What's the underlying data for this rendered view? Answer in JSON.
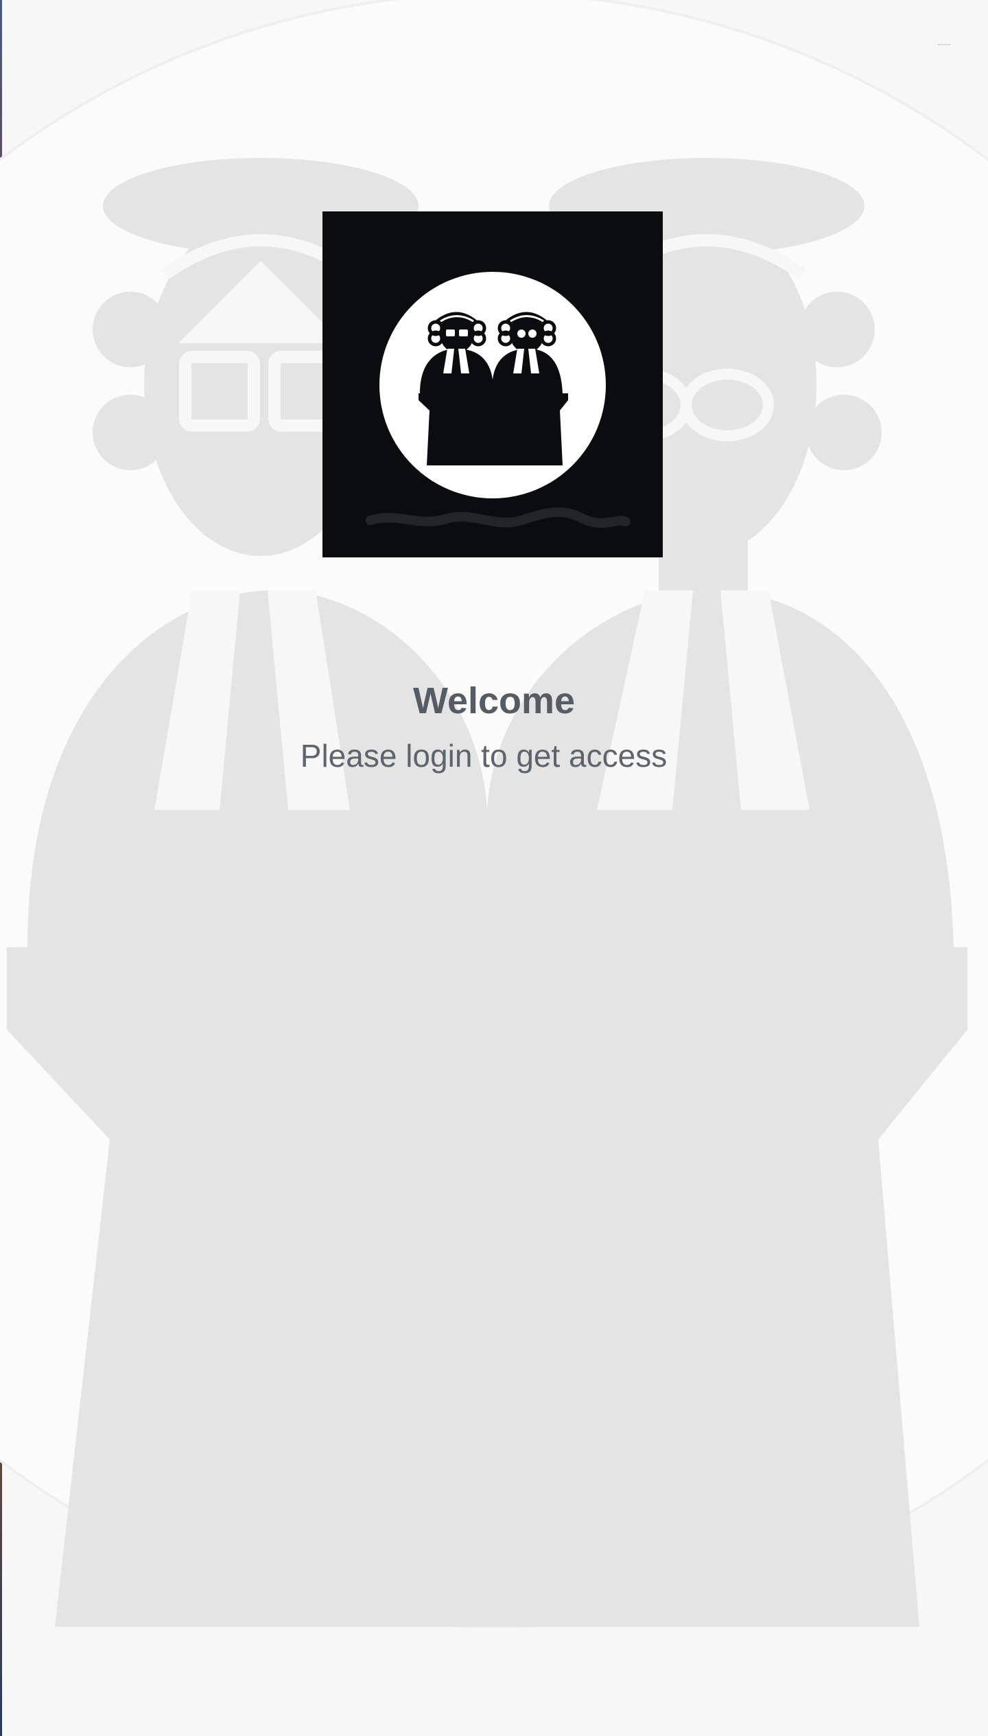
{
  "app": {
    "logo_icon": "judges-logo-icon",
    "background_icon": "judges-watermark-icon"
  },
  "login": {
    "welcome_title": "Welcome",
    "subtitle": "Please login to get access"
  },
  "colors": {
    "background": "#f7f7f7",
    "watermark": "#e4e4e4",
    "logo_background": "#0b0c0d",
    "text": "#565c64"
  }
}
